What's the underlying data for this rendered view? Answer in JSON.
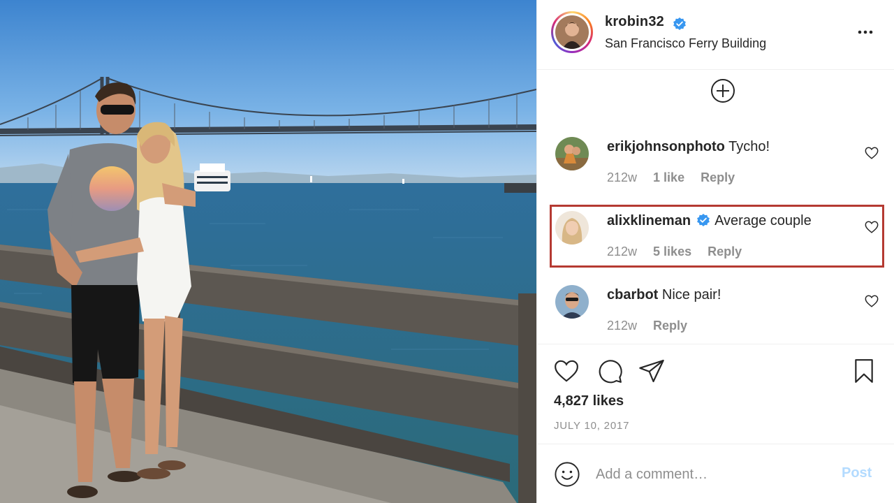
{
  "post": {
    "username": "krobin32",
    "verified": true,
    "location": "San Francisco Ferry Building",
    "likes": "4,827 likes",
    "date": "JULY 10, 2017"
  },
  "comments": [
    {
      "username": "erikjohnsonphoto",
      "verified": false,
      "text": "Tycho!",
      "age": "212w",
      "likes": "1 like",
      "reply": "Reply"
    },
    {
      "username": "alixklineman",
      "verified": true,
      "text": "Average couple",
      "age": "212w",
      "likes": "5 likes",
      "reply": "Reply",
      "highlighted": true
    },
    {
      "username": "cbarbot",
      "verified": false,
      "text": "Nice pair!",
      "age": "212w",
      "reply": "Reply"
    }
  ],
  "composer": {
    "placeholder": "Add a comment…",
    "post_label": "Post"
  },
  "icons": {
    "more": "more-options-icon",
    "load_more": "plus-circle-icon",
    "like": "heart-icon",
    "comment": "comment-bubble-icon",
    "share": "paper-plane-icon",
    "save": "bookmark-icon",
    "emoji": "smiley-icon",
    "verified": "verified-badge-icon"
  },
  "colors": {
    "verified": "#3897f0",
    "post_button_disabled": "#b3dbff",
    "highlight_box": "#b53a32",
    "secondary_text": "#8e8e8e"
  }
}
